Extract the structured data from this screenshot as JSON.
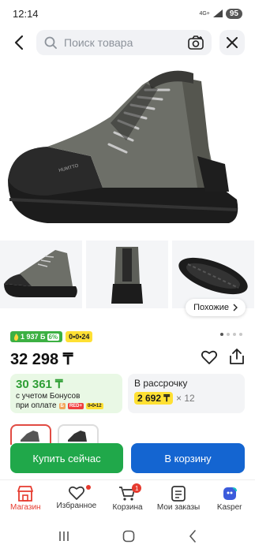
{
  "status_bar": {
    "time": "12:14",
    "network": "4G+",
    "battery": "95"
  },
  "search": {
    "placeholder": "Поиск товара"
  },
  "similar": {
    "label": "Похожие"
  },
  "badges": {
    "bonus_count": "1 937 Б",
    "bonus_pct": "6%",
    "installment_tag": "0•0•24"
  },
  "product": {
    "price": "32 298 ₸"
  },
  "bonus_card": {
    "price": "30 361 ₸",
    "line1": "с учетом Бонусов",
    "line2": "при оплате",
    "mini1": "Б",
    "mini2": "RED+",
    "mini3": "0•0•12"
  },
  "installment_card": {
    "title": "В рассрочку",
    "amount": "2 692 ₸",
    "multiplier": "× 12"
  },
  "actions": {
    "buy_now": "Купить сейчас",
    "to_cart": "В корзину"
  },
  "bottom_nav": {
    "items": [
      {
        "label": "Магазин"
      },
      {
        "label": "Избранное"
      },
      {
        "label": "Корзина"
      },
      {
        "label": "Мои заказы"
      },
      {
        "label": "Kasper"
      }
    ],
    "cart_count": "1"
  },
  "colors": {
    "accent_red": "#e63a2e",
    "buy_green": "#20a84a",
    "cart_blue": "#1465d1",
    "bonus_green": "#2f9e35",
    "highlight_yellow": "#ffe033"
  }
}
